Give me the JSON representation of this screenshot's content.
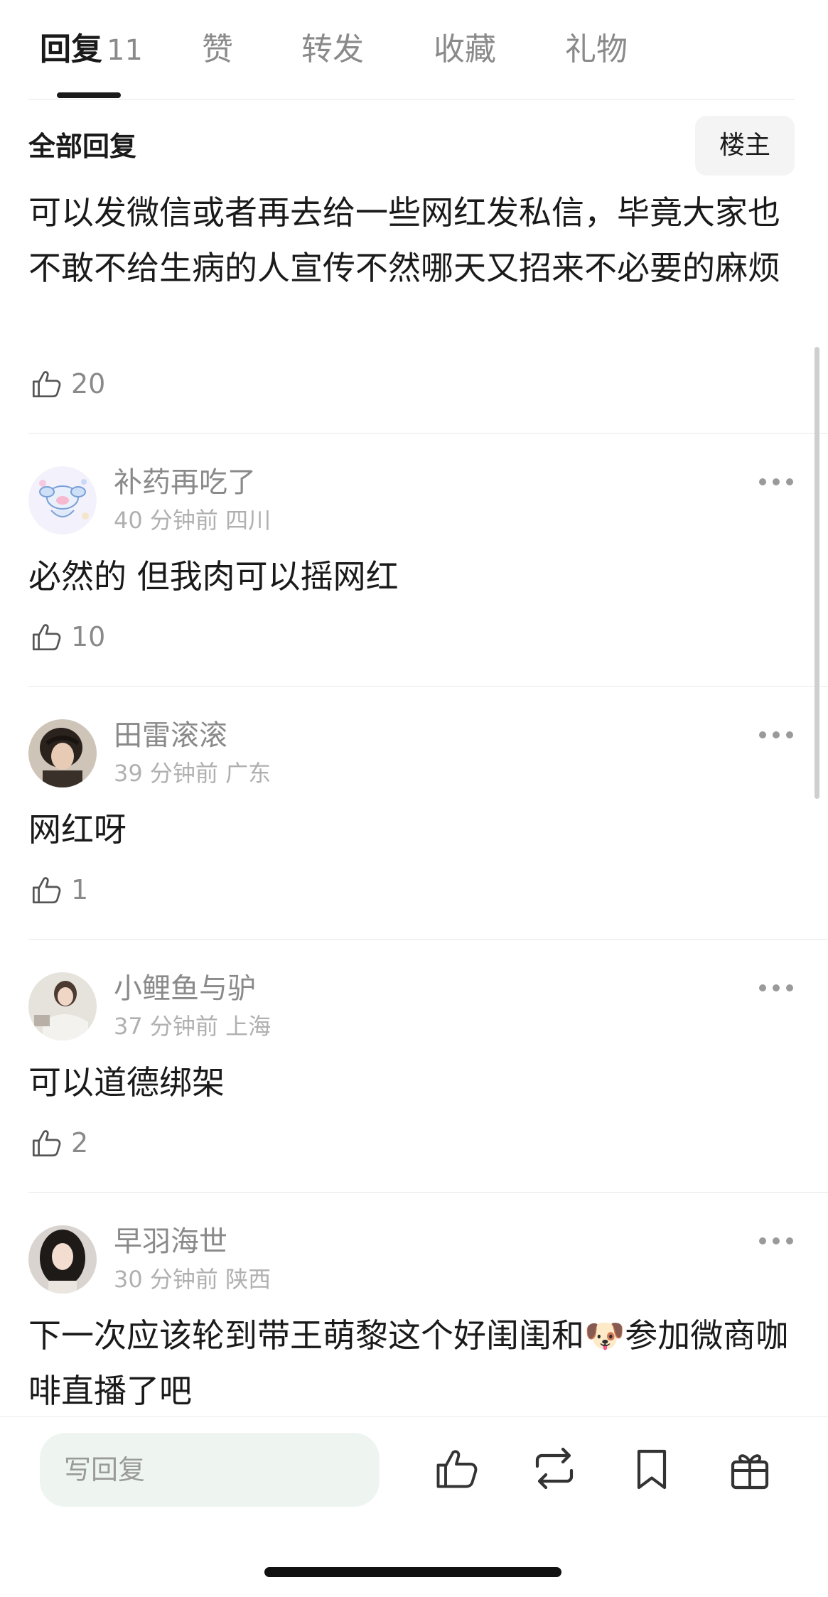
{
  "tabs": [
    {
      "label": "回复",
      "count": "11"
    },
    {
      "label": "赞"
    },
    {
      "label": "转发"
    },
    {
      "label": "收藏"
    },
    {
      "label": "礼物"
    }
  ],
  "section": {
    "title": "全部回复",
    "owner_button": "楼主"
  },
  "main_comment": {
    "text": "可以发微信或者再去给一些网红发私信，毕竟大家也不敢不给生病的人宣传不然哪天又招来不必要的麻烦",
    "likes": "20"
  },
  "comments": [
    {
      "username": "补药再吃了",
      "time": "40 分钟前",
      "location": "四川",
      "text": "必然的 但我肉可以摇网红",
      "likes": "10"
    },
    {
      "username": "田雷滚滚",
      "time": "39 分钟前",
      "location": "广东",
      "text": "网红呀",
      "likes": "1"
    },
    {
      "username": "小鲤鱼与驴",
      "time": "37 分钟前",
      "location": "上海",
      "text": "可以道德绑架",
      "likes": "2"
    },
    {
      "username": "早羽海世",
      "time": "30 分钟前",
      "location": "陕西",
      "text": "下一次应该轮到带王萌黎这个好闺闺和🐶参加微商咖啡直播了吧"
    }
  ],
  "bottom_bar": {
    "placeholder": "写回复",
    "icons": [
      "like-icon",
      "repost-icon",
      "bookmark-icon",
      "gift-icon"
    ]
  },
  "colors": {
    "text_primary": "#1a1a1a",
    "text_secondary": "#8a8a8a",
    "input_bg": "#eef5f1",
    "divider": "#e8e8e8"
  }
}
